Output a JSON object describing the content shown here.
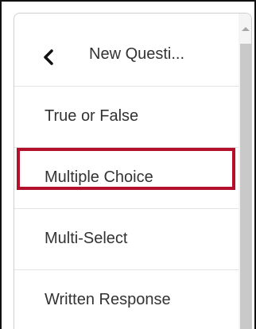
{
  "menu": {
    "header": {
      "back_icon": "chevron-left-icon",
      "title": "New Questi..."
    },
    "items": [
      {
        "label": "True or False"
      },
      {
        "label": "Multiple Choice",
        "highlighted": true
      },
      {
        "label": "Multi-Select"
      },
      {
        "label": "Written Response"
      }
    ]
  },
  "colors": {
    "highlight": "#b5102b",
    "text": "#333333",
    "divider": "#e3e3e3"
  }
}
